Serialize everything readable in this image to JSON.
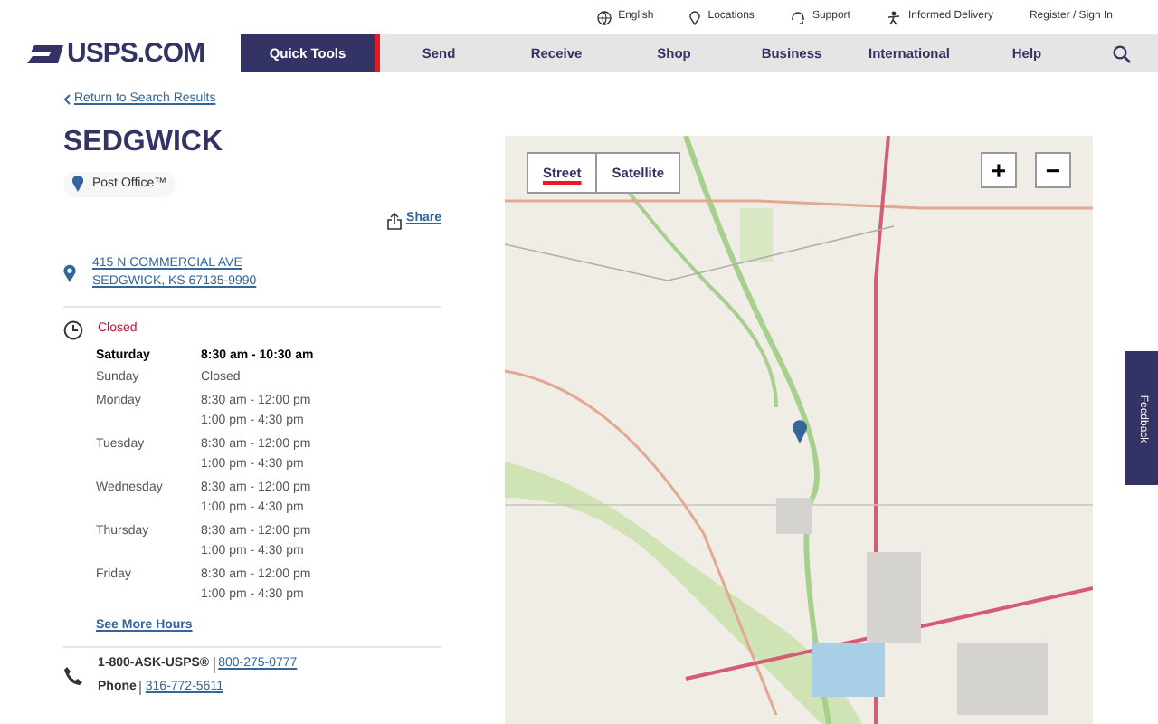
{
  "utility_links": [
    {
      "label": "English"
    },
    {
      "label": "Locations"
    },
    {
      "label": "Support"
    },
    {
      "label": "Informed Delivery"
    },
    {
      "label": "Register / Sign In"
    }
  ],
  "logo": "USPS.COM",
  "nav": [
    {
      "label": "Quick Tools",
      "selected": true
    },
    {
      "label": "Send",
      "selected": false
    },
    {
      "label": "Receive",
      "selected": false
    },
    {
      "label": "Shop",
      "selected": false
    },
    {
      "label": "Business",
      "selected": false
    },
    {
      "label": "International",
      "selected": false
    },
    {
      "label": "Help",
      "selected": false
    }
  ],
  "back_link": "Return to Search Results",
  "title": "SEDGWICK",
  "location_type": "Post Office™",
  "share": "Share",
  "address": [
    "415 N COMMERCIAL AVE",
    "SEDGWICK, KS 67135-9990"
  ],
  "status": "Closed",
  "hours": [
    {
      "day": "Saturday",
      "times": [
        "8:30 am - 10:30 am"
      ],
      "today": true
    },
    {
      "day": "Sunday",
      "times": [
        "Closed"
      ],
      "today": false
    },
    {
      "day": "Monday",
      "times": [
        "8:30 am - 12:00 pm",
        "1:00 pm - 4:30 pm"
      ],
      "today": false
    },
    {
      "day": "Tuesday",
      "times": [
        "8:30 am - 12:00 pm",
        "1:00 pm - 4:30 pm"
      ],
      "today": false
    },
    {
      "day": "Wednesday",
      "times": [
        "8:30 am - 12:00 pm",
        "1:00 pm - 4:30 pm"
      ],
      "today": false
    },
    {
      "day": "Thursday",
      "times": [
        "8:30 am - 12:00 pm",
        "1:00 pm - 4:30 pm"
      ],
      "today": false
    },
    {
      "day": "Friday",
      "times": [
        "8:30 am - 12:00 pm",
        "1:00 pm - 4:30 pm"
      ],
      "today": false
    }
  ],
  "more_hours": "See More Hours",
  "phones": [
    {
      "label": "1-800-ASK-USPS®",
      "number": "800-275-0777"
    },
    {
      "label": "Phone",
      "number": "316-772-5611"
    }
  ],
  "map": {
    "views": [
      {
        "label": "Street",
        "selected": true
      },
      {
        "label": "Satellite",
        "selected": false
      }
    ],
    "zoom_in": "+",
    "zoom_out": "−"
  },
  "feedback": "Feedback"
}
